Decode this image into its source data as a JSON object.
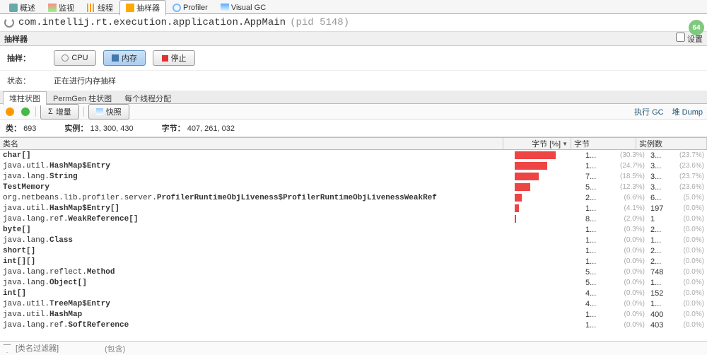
{
  "tabs": [
    {
      "label": "概述",
      "icon": "chart-icon"
    },
    {
      "label": "监视",
      "icon": "monitor-icon"
    },
    {
      "label": "线程",
      "icon": "threads-icon"
    },
    {
      "label": "抽样器",
      "icon": "sampler-icon",
      "active": true
    },
    {
      "label": "Profiler",
      "icon": "profiler-icon"
    },
    {
      "label": "Visual GC",
      "icon": "gc-icon"
    }
  ],
  "process": {
    "name": "com.intellij.rt.execution.application.AppMain",
    "pid": "(pid 5148)"
  },
  "badge": "64",
  "section": {
    "title": "抽样器",
    "settings": "设置"
  },
  "controls": {
    "label": "抽样：",
    "cpu": "CPU",
    "mem": "内存",
    "stop": "停止"
  },
  "status": {
    "label": "状态：",
    "text": "正在进行内存抽样"
  },
  "subtabs": [
    {
      "label": "堆柱状图",
      "active": true
    },
    {
      "label": "PermGen 柱状图"
    },
    {
      "label": "每个线程分配"
    }
  ],
  "toolbar2": {
    "delta": "增量",
    "snapshot": "快照",
    "gc": "执行 GC",
    "dump": "堆 Dump"
  },
  "summary": {
    "classes_label": "类：",
    "classes": "693",
    "inst_label": "实例：",
    "inst": "13, 300, 430",
    "bytes_label": "字节：",
    "bytes": "407, 261, 032"
  },
  "columns": {
    "name": "类名",
    "barcol": "字节 [%]",
    "bytes": "字节",
    "inst": "实例数"
  },
  "rows": [
    {
      "pkg": "",
      "cls": "char[]",
      "bar": 58,
      "bv": "1...",
      "bp": "(30.3%)",
      "iv": "3...",
      "ip": "(23.7%)"
    },
    {
      "pkg": "java.util.",
      "cls": "HashMap$Entry",
      "bar": 46,
      "bv": "1...",
      "bp": "(24.7%)",
      "iv": "3...",
      "ip": "(23.6%)"
    },
    {
      "pkg": "java.lang.",
      "cls": "String",
      "bar": 34,
      "bv": "7...",
      "bp": "(18.5%)",
      "iv": "3...",
      "ip": "(23.7%)"
    },
    {
      "pkg": "",
      "cls": "TestMemory",
      "bar": 22,
      "bv": "5...",
      "bp": "(12.3%)",
      "iv": "3...",
      "ip": "(23.6%)"
    },
    {
      "pkg": "org.netbeans.lib.profiler.server.",
      "cls": "ProfilerRuntimeObjLiveness$ProfilerRuntimeObjLivenessWeakRef",
      "bar": 10,
      "bv": "2...",
      "bp": "(6.6%)",
      "iv": "6...",
      "ip": "(5.0%)"
    },
    {
      "pkg": "java.util.",
      "cls": "HashMap$Entry[]",
      "bar": 6,
      "bv": "1...",
      "bp": "(4.1%)",
      "iv": "197",
      "ip": "(0.0%)"
    },
    {
      "pkg": "java.lang.ref.",
      "cls": "WeakReference[]",
      "bar": 2,
      "bv": "8...",
      "bp": "(2.0%)",
      "iv": "1",
      "ip": "(0.0%)"
    },
    {
      "pkg": "",
      "cls": "byte[]",
      "bar": 0,
      "bv": "1...",
      "bp": "(0.3%)",
      "iv": "2...",
      "ip": "(0.0%)"
    },
    {
      "pkg": "java.lang.",
      "cls": "Class",
      "bar": 0,
      "bv": "1...",
      "bp": "(0.0%)",
      "iv": "1...",
      "ip": "(0.0%)"
    },
    {
      "pkg": "",
      "cls": "short[]",
      "bar": 0,
      "bv": "1...",
      "bp": "(0.0%)",
      "iv": "2...",
      "ip": "(0.0%)"
    },
    {
      "pkg": "",
      "cls": "int[][]",
      "bar": 0,
      "bv": "1...",
      "bp": "(0.0%)",
      "iv": "2...",
      "ip": "(0.0%)"
    },
    {
      "pkg": "java.lang.reflect.",
      "cls": "Method",
      "bar": 0,
      "bv": "5...",
      "bp": "(0.0%)",
      "iv": "748",
      "ip": "(0.0%)"
    },
    {
      "pkg": "java.lang.",
      "cls": "Object[]",
      "bar": 0,
      "bv": "5...",
      "bp": "(0.0%)",
      "iv": "1...",
      "ip": "(0.0%)"
    },
    {
      "pkg": "",
      "cls": "int[]",
      "bar": 0,
      "bv": "4...",
      "bp": "(0.0%)",
      "iv": "152",
      "ip": "(0.0%)"
    },
    {
      "pkg": "java.util.",
      "cls": "TreeMap$Entry",
      "bar": 0,
      "bv": "4...",
      "bp": "(0.0%)",
      "iv": "1...",
      "ip": "(0.0%)"
    },
    {
      "pkg": "java.util.",
      "cls": "HashMap",
      "bar": 0,
      "bv": "1...",
      "bp": "(0.0%)",
      "iv": "400",
      "ip": "(0.0%)"
    },
    {
      "pkg": "java.lang.ref.",
      "cls": "SoftReference",
      "bar": 0,
      "bv": "1...",
      "bp": "(0.0%)",
      "iv": "403",
      "ip": "(0.0%)"
    }
  ],
  "filter": {
    "placeholder": "[类名过滤器]",
    "mode": "(包含)"
  }
}
